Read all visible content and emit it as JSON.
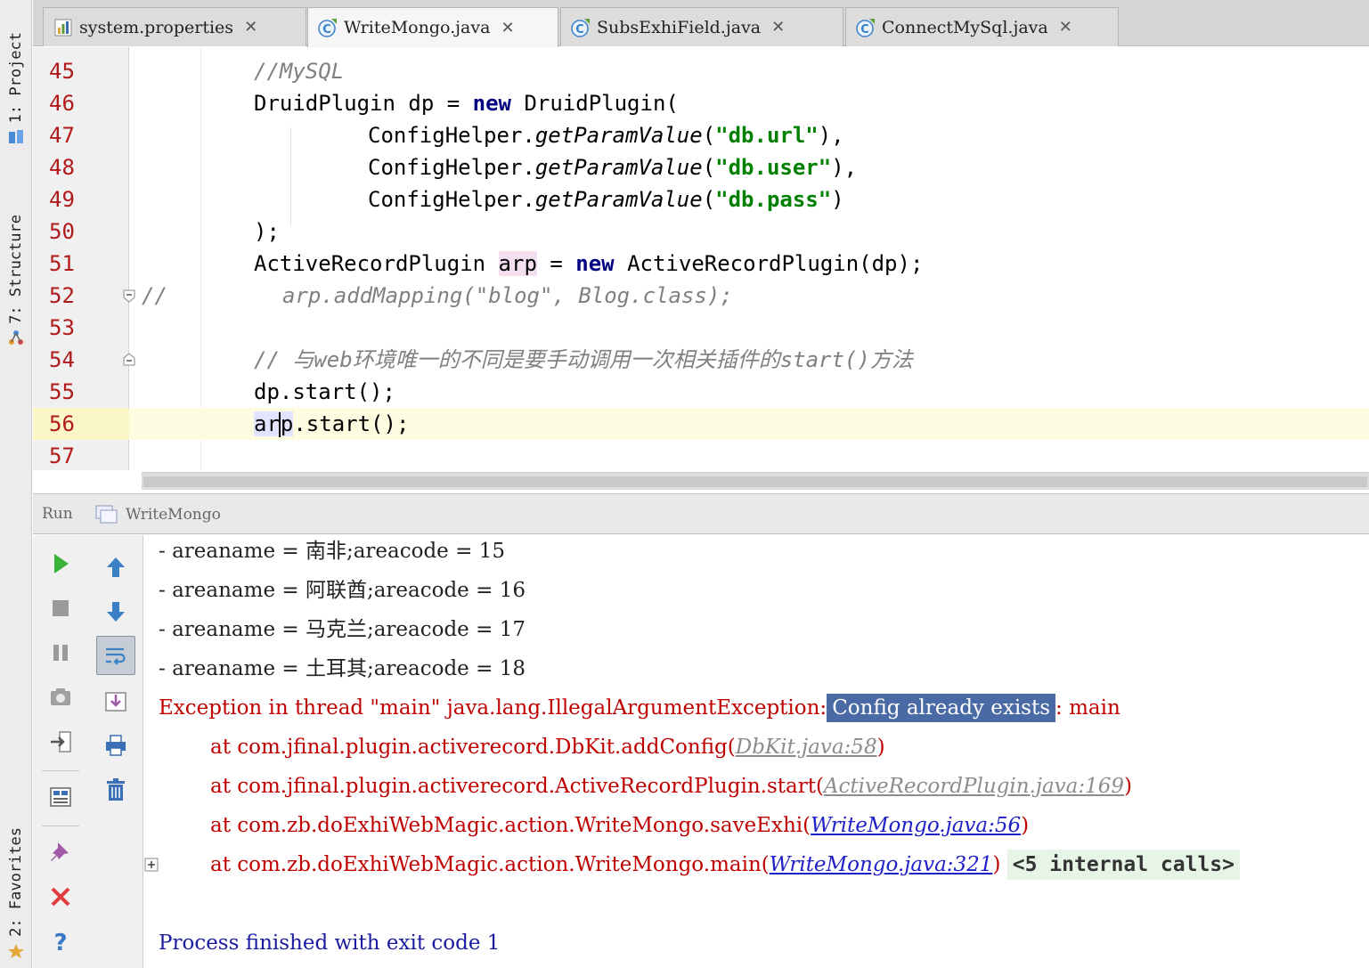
{
  "left_strip": {
    "project_label": "1: Project",
    "structure_label": "7: Structure",
    "favorites_label": "2: Favorites"
  },
  "tabs": [
    {
      "label": "system.properties",
      "close": "✕",
      "icon": "properties-file-icon"
    },
    {
      "label": "WriteMongo.java",
      "close": "✕",
      "icon": "java-class-icon"
    },
    {
      "label": "SubsExhiField.java",
      "close": "✕",
      "icon": "java-class-icon"
    },
    {
      "label": "ConnectMySql.java",
      "close": "✕",
      "icon": "java-class-icon"
    }
  ],
  "active_tab": "WriteMongo.java",
  "editor": {
    "line_numbers": [
      "45",
      "46",
      "47",
      "48",
      "49",
      "50",
      "51",
      "52",
      "53",
      "54",
      "55",
      "56",
      "57"
    ],
    "current_line": "56",
    "lines": {
      "l45_comment": "//MySQL",
      "l46_a": "DruidPlugin dp = ",
      "l46_kw": "new",
      "l46_b": " DruidPlugin(",
      "l47_a": "ConfigHelper.",
      "l47_m": "getParamValue",
      "l47_p": "(",
      "l47_s": "\"db.url\"",
      "l47_e": "),",
      "l48_a": "ConfigHelper.",
      "l48_m": "getParamValue",
      "l48_p": "(",
      "l48_s": "\"db.user\"",
      "l48_e": "),",
      "l49_a": "ConfigHelper.",
      "l49_m": "getParamValue",
      "l49_p": "(",
      "l49_s": "\"db.pass\"",
      "l49_e": ")",
      "l50": ");",
      "l51_a": "ActiveRecordPlugin ",
      "l51_var": "arp",
      "l51_b": " = ",
      "l51_kw": "new",
      "l51_c": " ActiveRecordPlugin(dp);",
      "l52_slash": "//",
      "l52_code": "arp.addMapping(\"blog\", Blog.class);",
      "l54_comment": "// 与web环境唯一的不同是要手动调用一次相关插件的start()方法",
      "l55": "dp.start();",
      "l56_a": "ar",
      "l56_b": "p",
      "l56_c": ".start();"
    }
  },
  "run_panel": {
    "label": "Run",
    "config_name": "WriteMongo"
  },
  "console": {
    "lines": [
      "- areaname = 南非;areacode = 15",
      "- areaname = 阿联酋;areacode = 16",
      "- areaname = 马克兰;areacode = 17",
      "- areaname = 土耳其;areacode = 18"
    ],
    "exception_prefix": "Exception in thread \"main\" java.lang.IllegalArgumentException:",
    "exception_selected": "Config already exists",
    "exception_suffix": ": main",
    "stack": [
      {
        "at": "at com.jfinal.plugin.activerecord.DbKit.addConfig(",
        "link": "DbKit.java:58",
        "end": ")"
      },
      {
        "at": "at com.jfinal.plugin.activerecord.ActiveRecordPlugin.start(",
        "link": "ActiveRecordPlugin.java:169",
        "end": ")"
      },
      {
        "at": "at com.zb.doExhiWebMagic.action.WriteMongo.saveExhi(",
        "link": "WriteMongo.java:56",
        "end": ")"
      },
      {
        "at": "at com.zb.doExhiWebMagic.action.WriteMongo.main(",
        "link": "WriteMongo.java:321",
        "end": ")"
      }
    ],
    "internal_calls": "<5 internal calls>",
    "process_finished": "Process finished with exit code 1"
  },
  "colors": {
    "keyword": "#000080",
    "string": "#008000",
    "error": "#c00000",
    "line_number": "#b11a1a",
    "selection": "#4a6aa6"
  }
}
